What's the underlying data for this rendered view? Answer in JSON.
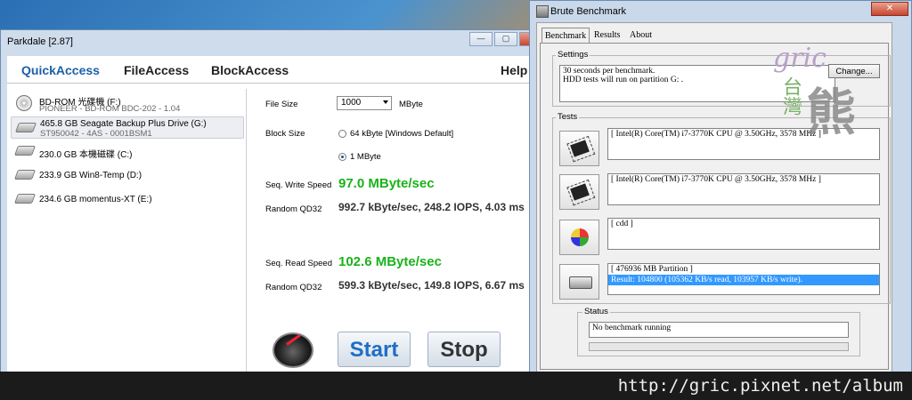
{
  "parkdale": {
    "title": "Parkdale [2.87]",
    "controls": [
      "—",
      "▢",
      "✕"
    ],
    "tabs": [
      "QuickAccess",
      "FileAccess",
      "BlockAccess",
      "Help"
    ],
    "drives": [
      {
        "line1": "BD-ROM 光碟機 (F:)",
        "line2": "PIONEER - BD-ROM  BDC-202 - 1.04"
      },
      {
        "line1": "465.8 GB Seagate Backup Plus Drive (G:)",
        "line2": "ST950042 - 4AS - 0001BSM1"
      },
      {
        "line1": "230.0 GB 本機磁碟 (C:)"
      },
      {
        "line1": "233.9 GB Win8-Temp (D:)"
      },
      {
        "line1": "234.6 GB momentus-XT (E:)"
      }
    ],
    "file_size_label": "File Size",
    "file_size_value": "1000",
    "file_size_unit": "MByte",
    "block_size_label": "Block Size",
    "block_opt1": "64 kByte [Windows Default]",
    "block_opt2": "1 MByte",
    "seq_write_label": "Seq. Write Speed",
    "seq_write_value": "97.0 MByte/sec",
    "rand_write_label": "Random QD32",
    "rand_write_value": "992.7 kByte/sec, 248.2 IOPS, 4.03 ms",
    "seq_read_label": "Seq. Read Speed",
    "seq_read_value": "102.6 MByte/sec",
    "rand_read_label": "Random QD32",
    "rand_read_value": "599.3 kByte/sec, 149.8 IOPS, 6.67 ms",
    "start_label": "Start",
    "stop_label": "Stop"
  },
  "brute": {
    "title": "Brute Benchmark",
    "close": "✕",
    "tabs": [
      "Benchmark",
      "Results",
      "About"
    ],
    "settings_title": "Settings",
    "settings_line1": "30 seconds per benchmark.",
    "settings_line2": "HDD tests will run on partition G: .",
    "change_label": "Change...",
    "tests_title": "Tests",
    "test1": "[ Intel(R) Core(TM) i7-3770K CPU @ 3.50GHz, 3578 MHz ]",
    "test2": "[ Intel(R) Core(TM) i7-3770K CPU @ 3.50GHz, 3578 MHz ]",
    "test3": "[ cdd ]",
    "test4_line1": "[ 476936 MB Partition ]",
    "test4_line2": "Result: 104800 (105362 KB/s read, 103957 KB/s write).",
    "status_title": "Status",
    "status_text": "No benchmark running"
  },
  "watermark": {
    "gric": "gric",
    "tw": "台灣",
    "bear": "熊"
  },
  "url": "http://gric.pixnet.net/album"
}
